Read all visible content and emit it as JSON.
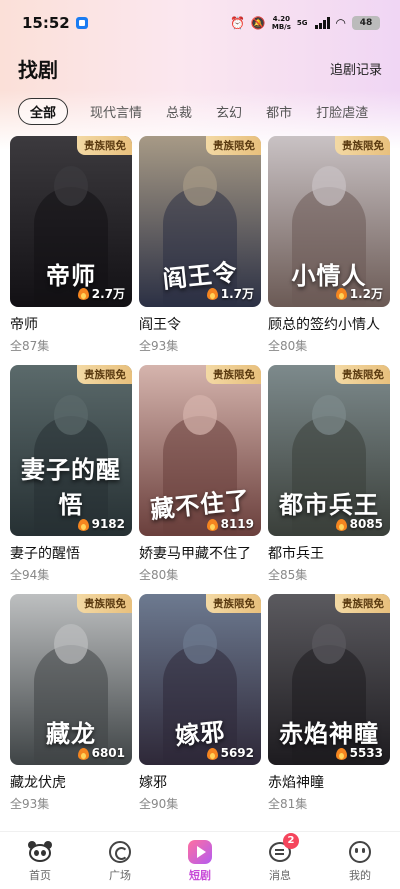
{
  "status": {
    "time": "15:52",
    "net_speed_value": "4.20",
    "net_speed_unit": "MB/s",
    "signal_label": "5G",
    "battery": "48"
  },
  "header": {
    "title": "找剧",
    "history_link": "追剧记录"
  },
  "tabs": [
    "全部",
    "现代言情",
    "总裁",
    "玄幻",
    "都市",
    "打脸虐渣"
  ],
  "badge_text": "贵族限免",
  "cards": [
    {
      "title": "帝师",
      "episodes": "全87集",
      "heat": "2.7万",
      "art": "帝师",
      "c1": "#3c3a3e",
      "c2": "#121014"
    },
    {
      "title": "阎王令",
      "episodes": "全93集",
      "heat": "1.7万",
      "art": "阎王令",
      "c1": "#a79a86",
      "c2": "#2b3044"
    },
    {
      "title": "顾总的签约小情人",
      "episodes": "全80集",
      "heat": "1.2万",
      "art": "小情人",
      "c1": "#c9c2c4",
      "c2": "#6b5a55"
    },
    {
      "title": "妻子的醒悟",
      "episodes": "全94集",
      "heat": "9182",
      "art": "妻子的醒悟",
      "c1": "#5b6a6b",
      "c2": "#263033"
    },
    {
      "title": "娇妻马甲藏不住了",
      "episodes": "全80集",
      "heat": "8119",
      "art": "藏不住了",
      "c1": "#d5b4ad",
      "c2": "#6a3f3c"
    },
    {
      "title": "都市兵王",
      "episodes": "全85集",
      "heat": "8085",
      "art": "都市兵王",
      "c1": "#7d8a8c",
      "c2": "#3a3f3a"
    },
    {
      "title": "藏龙伏虎",
      "episodes": "全93集",
      "heat": "6801",
      "art": "藏龙",
      "c1": "#bdbfc0",
      "c2": "#3f4446"
    },
    {
      "title": "嫁邪",
      "episodes": "全90集",
      "heat": "5692",
      "art": "嫁邪",
      "c1": "#6d7a90",
      "c2": "#2e2838"
    },
    {
      "title": "赤焰神瞳",
      "episodes": "全81集",
      "heat": "5533",
      "art": "赤焰神瞳",
      "c1": "#5b5a5f",
      "c2": "#1d1b1f"
    }
  ],
  "nav": [
    {
      "label": "首页",
      "icon": "panda-icon"
    },
    {
      "label": "广场",
      "icon": "plaza-icon"
    },
    {
      "label": "短剧",
      "icon": "drama-icon"
    },
    {
      "label": "消息",
      "icon": "message-icon",
      "badge": "2"
    },
    {
      "label": "我的",
      "icon": "profile-icon"
    }
  ],
  "colors": {
    "accent": "#c84bd8",
    "badge_gold": "#e8c07d",
    "notification_red": "#f5455c"
  }
}
